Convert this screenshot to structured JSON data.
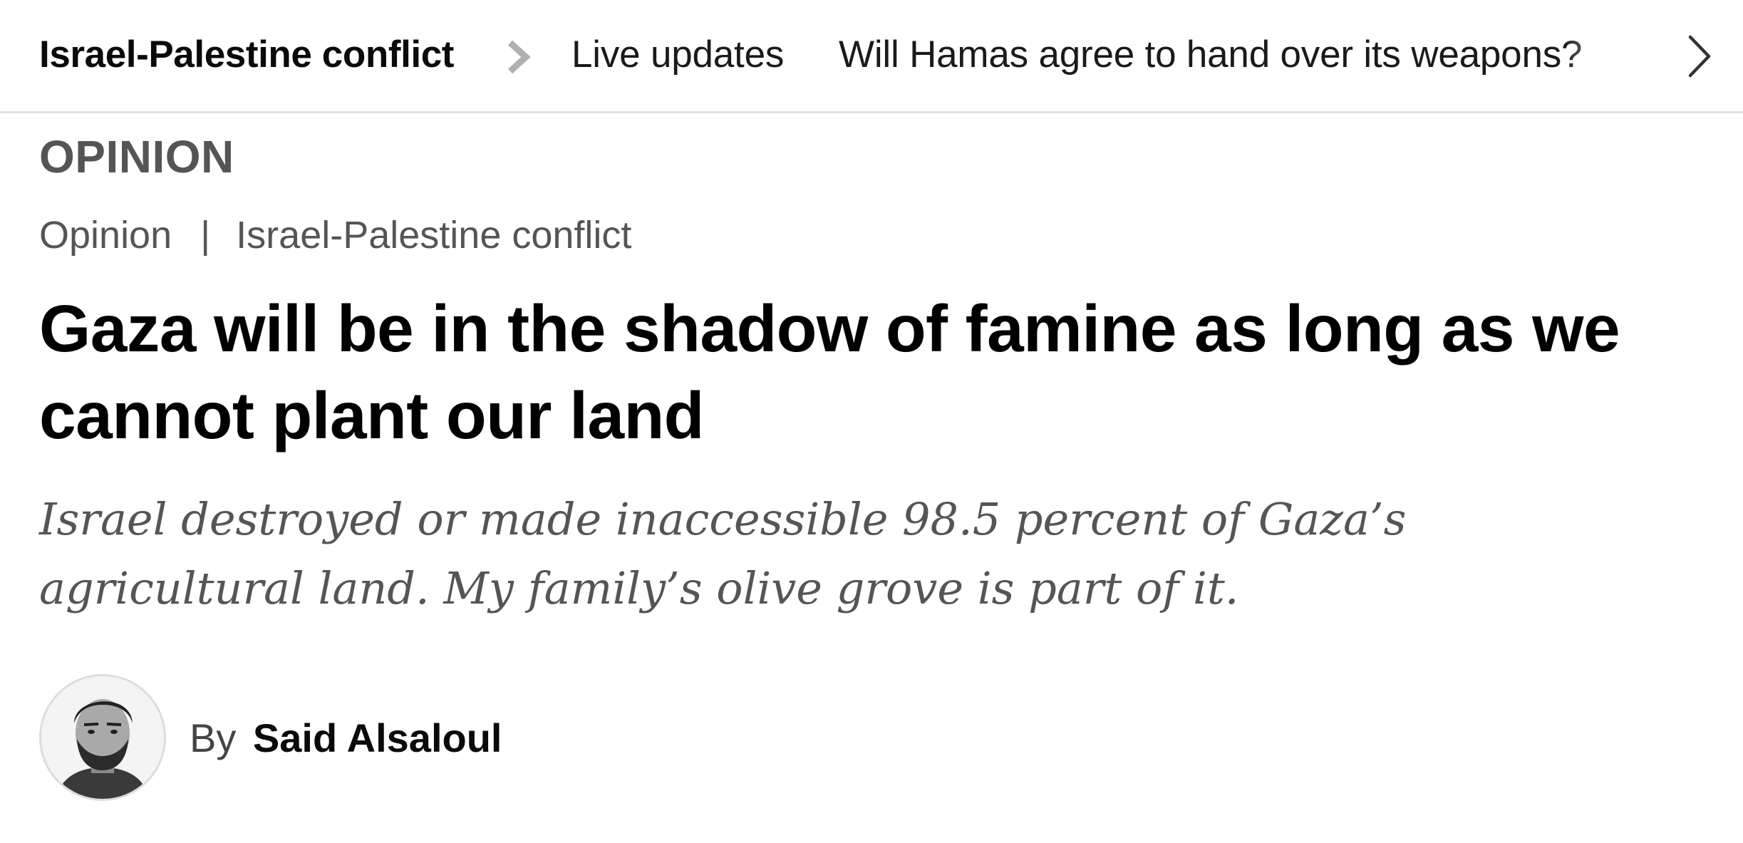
{
  "topic_bar": {
    "topic_title": "Israel-Palestine conflict",
    "links": [
      {
        "label": "Live updates"
      },
      {
        "label": "Will Hamas agree to hand over its weapons?"
      }
    ]
  },
  "article": {
    "section_label": "OPINION",
    "breadcrumb": {
      "items": [
        "Opinion",
        "Israel-Palestine conflict"
      ],
      "separator": "|"
    },
    "headline": "Gaza will be in the shadow of famine as long as we cannot plant our land",
    "dek": "Israel destroyed or made inaccessible 98.5 percent of Gaza’s agricultural land. My family’s olive grove is part of it.",
    "byline": {
      "prefix": "By",
      "author": "Said Alsaloul"
    }
  },
  "icons": {
    "topic_separator": "chevron-right-icon",
    "scroll_right": "chevron-right-icon"
  },
  "colors": {
    "text_primary": "#000000",
    "text_secondary": "#555555",
    "separator_chevron": "#b0b0b0",
    "divider": "#e3e3e3"
  }
}
